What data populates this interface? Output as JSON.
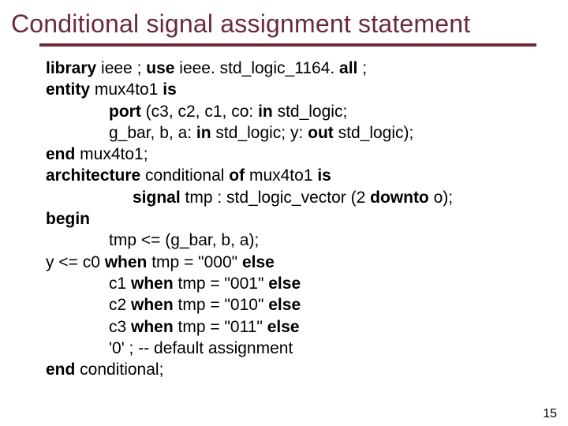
{
  "title": "Conditional signal assignment statement",
  "code": {
    "l1a": "library",
    "l1b": " ieee ;    ",
    "l1c": "use",
    "l1d": " ieee. std_logic_1164. ",
    "l1e": "all",
    "l1f": " ;",
    "l2a": "entity",
    "l2b": " mux4to1 ",
    "l2c": "is",
    "l3a": "port",
    "l3b": " (c3, c2, c1, co: ",
    "l3c": "in",
    "l3d": " std_logic;",
    "l4a": "g_bar, b, a: ",
    "l4b": "in",
    "l4c": " std_logic;  y: ",
    "l4d": "out",
    "l4e": " std_logic);",
    "l5a": "end",
    "l5b": " mux4to1;",
    "l6a": "architecture",
    "l6b": " conditional ",
    "l6c": "of",
    "l6d": " mux4to1 ",
    "l6e": "is",
    "l7a": "signal",
    "l7b": " tmp : std_logic_vector (2 ",
    "l7c": "downto",
    "l7d": " o);",
    "l8a": "begin",
    "l9": "tmp <= (g_bar, b, a);",
    "l10a": "y <=    c0 ",
    "l10b": "when",
    "l10c": " tmp = \"000\" ",
    "l10d": "else",
    "l11a": "c1 ",
    "l11b": "when",
    "l11c": " tmp = \"001\" ",
    "l11d": "else",
    "l12a": "c2 ",
    "l12b": "when",
    "l12c": " tmp = \"010\" ",
    "l12d": "else",
    "l13a": "c3 ",
    "l13b": "when",
    "l13c": " tmp = \"011\" ",
    "l13d": "else",
    "l14": "'0' ;                    -- default assignment",
    "l15a": "end",
    "l15b": " conditional;"
  },
  "page_number": "15"
}
